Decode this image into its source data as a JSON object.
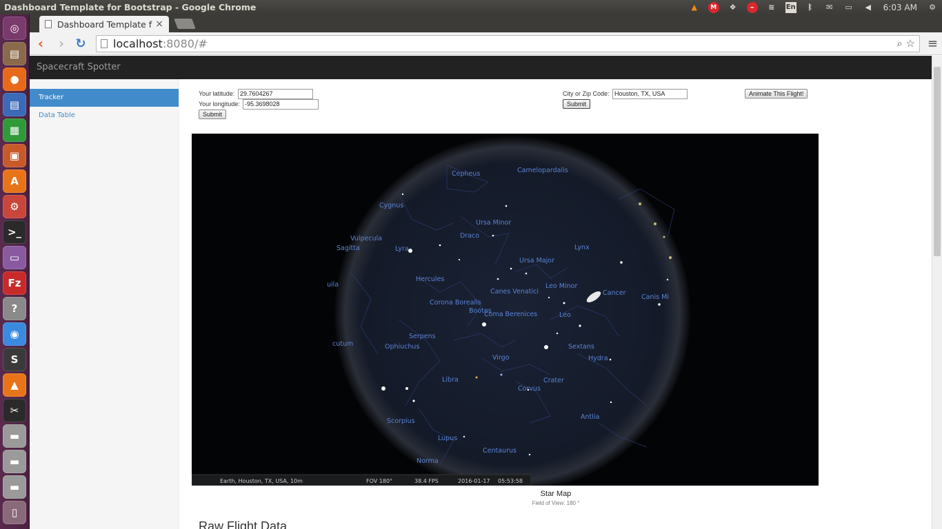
{
  "os": {
    "window_title": "Dashboard Template for Bootstrap - Google Chrome",
    "clock": "6:03 AM",
    "keyboard_layout": "En",
    "tray_icons": [
      "vlc-icon",
      "mega-icon",
      "dropbox-icon",
      "stop-icon",
      "wifi-icon",
      "keyboard-icon",
      "bluetooth-icon",
      "mail-icon",
      "battery-icon",
      "volume-icon",
      "gear-icon"
    ],
    "launcher_items": [
      {
        "name": "ubuntu-dash-icon",
        "glyph": "◎",
        "color": "#7a3a6c"
      },
      {
        "name": "files-icon",
        "glyph": "▤",
        "color": "#8a6a4a"
      },
      {
        "name": "firefox-icon",
        "glyph": "●",
        "color": "#e66a1a"
      },
      {
        "name": "writer-icon",
        "glyph": "▤",
        "color": "#3a6ab8"
      },
      {
        "name": "calc-icon",
        "glyph": "▦",
        "color": "#2f9a3a"
      },
      {
        "name": "impress-icon",
        "glyph": "▣",
        "color": "#c85a2a"
      },
      {
        "name": "software-center-icon",
        "glyph": "A",
        "color": "#e8741a"
      },
      {
        "name": "settings-icon",
        "glyph": "⚙",
        "color": "#c8463a"
      },
      {
        "name": "terminal-icon",
        "glyph": ">_",
        "color": "#2a2a2a"
      },
      {
        "name": "window-icon",
        "glyph": "▭",
        "color": "#8a5aa0"
      },
      {
        "name": "filezilla-icon",
        "glyph": "Fz",
        "color": "#c82a2a"
      },
      {
        "name": "help-icon",
        "glyph": "?",
        "color": "#8a8a8a"
      },
      {
        "name": "chrome-icon",
        "glyph": "◉",
        "color": "#3a8ae0"
      },
      {
        "name": "sublime-icon",
        "glyph": "S",
        "color": "#3a3a3a"
      },
      {
        "name": "vlc-launcher-icon",
        "glyph": "▲",
        "color": "#e8741a"
      },
      {
        "name": "video-editor-icon",
        "glyph": "✂",
        "color": "#2a2a2a"
      },
      {
        "name": "drive-icon-1",
        "glyph": "▬",
        "color": "#9a9a9a"
      },
      {
        "name": "drive-icon-2",
        "glyph": "▬",
        "color": "#9a9a9a"
      },
      {
        "name": "drive-icon-3",
        "glyph": "▬",
        "color": "#9a9a9a"
      },
      {
        "name": "trash-icon",
        "glyph": "▯",
        "color": "#8a6a7a"
      }
    ]
  },
  "browser": {
    "tab_title": "Dashboard Template fo",
    "url_host": "localhost",
    "url_rest": ":8080/#"
  },
  "app": {
    "brand": "Spacecraft Spotter",
    "sidebar": [
      {
        "label": "Tracker",
        "active": true
      },
      {
        "label": "Data Table",
        "active": false
      }
    ],
    "form": {
      "latitude_label": "Your latitude:",
      "latitude_value": "29.7604267",
      "longitude_label": "Your longitude:",
      "longitude_value": "-95.3698028",
      "submit_label": "Submit",
      "city_label": "City or Zip Code:",
      "city_value": "Houston, TX, USA",
      "city_submit_label": "Submit",
      "animate_label": "Animate This Flight!"
    },
    "star_map": {
      "status_location": "Earth, Houston, TX, USA, 10m",
      "status_fov": "FOV 180°",
      "status_fps": "38.4 FPS",
      "status_date": "2016-01-17",
      "status_time": "05:53:58",
      "constellations": [
        "Cepheus",
        "Camelopardalis",
        "Cygnus",
        "Ursa Minor",
        "Draco",
        "Vulpecula",
        "Sagitta",
        "Lyra",
        "Lynx",
        "Ursa Major",
        "Hercules",
        "Leo Minor",
        "uila",
        "Canes Venatici",
        "Cancer",
        "Canis Mi",
        "Corona Borealis",
        "Bootes",
        "Coma Berenices",
        "Leo",
        "Serpens",
        "cutum",
        "Ophiuchus",
        "Sextans",
        "Virgo",
        "Hydra",
        "Libra",
        "Crater",
        "Corvus",
        "Scorpius",
        "Antlia",
        "Lupus",
        "Centaurus",
        "Norma"
      ],
      "caption": "Star Map",
      "subcaption": "Field of View: 180 °"
    },
    "raw_heading": "Raw Flight Data"
  }
}
